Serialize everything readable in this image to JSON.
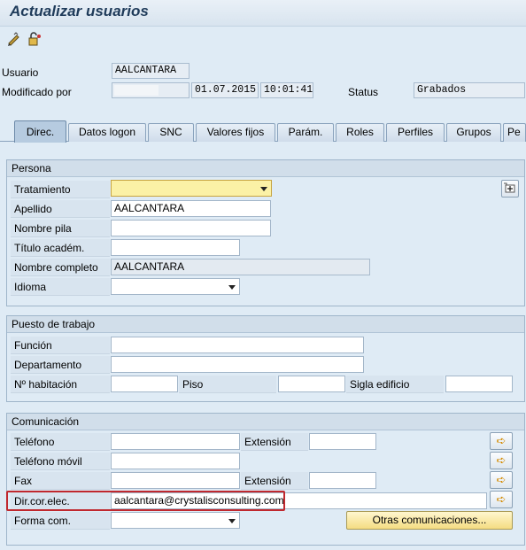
{
  "title": "Actualizar usuarios",
  "toolbar": {
    "icons": [
      "pencil-icon",
      "lock-icon"
    ]
  },
  "header": {
    "usuario_label": "Usuario",
    "usuario_value": "AALCANTARA",
    "modificado_label": "Modificado por",
    "date": "01.07.2015",
    "time": "10:01:41",
    "status_label": "Status",
    "status_value": "Grabados"
  },
  "tabs": [
    "Direc.",
    "Datos logon",
    "SNC",
    "Valores fijos",
    "Parám.",
    "Roles",
    "Perfiles",
    "Grupos",
    "Pe"
  ],
  "persona": {
    "header": "Persona",
    "tratamiento": "Tratamiento",
    "apellido": "Apellido",
    "apellido_value": "AALCANTARA",
    "nombre_pila": "Nombre pila",
    "titulo": "Título académ.",
    "nombre_completo": "Nombre completo",
    "nombre_completo_value": "AALCANTARA",
    "idioma": "Idioma"
  },
  "puesto": {
    "header": "Puesto de trabajo",
    "funcion": "Función",
    "departamento": "Departamento",
    "habitacion": "Nº habitación",
    "piso": "Piso",
    "sigla": "Sigla edificio"
  },
  "comunicacion": {
    "header": "Comunicación",
    "telefono": "Teléfono",
    "extension1": "Extensión",
    "movil": "Teléfono móvil",
    "fax": "Fax",
    "extension2": "Extensión",
    "email_label": "Dir.cor.elec.",
    "email_value": "aalcantara@crystalisconsulting.com",
    "forma": "Forma com.",
    "otras": "Otras comunicaciones..."
  },
  "colors": {
    "highlight": "#c0282e",
    "button": "#f4dc82"
  }
}
